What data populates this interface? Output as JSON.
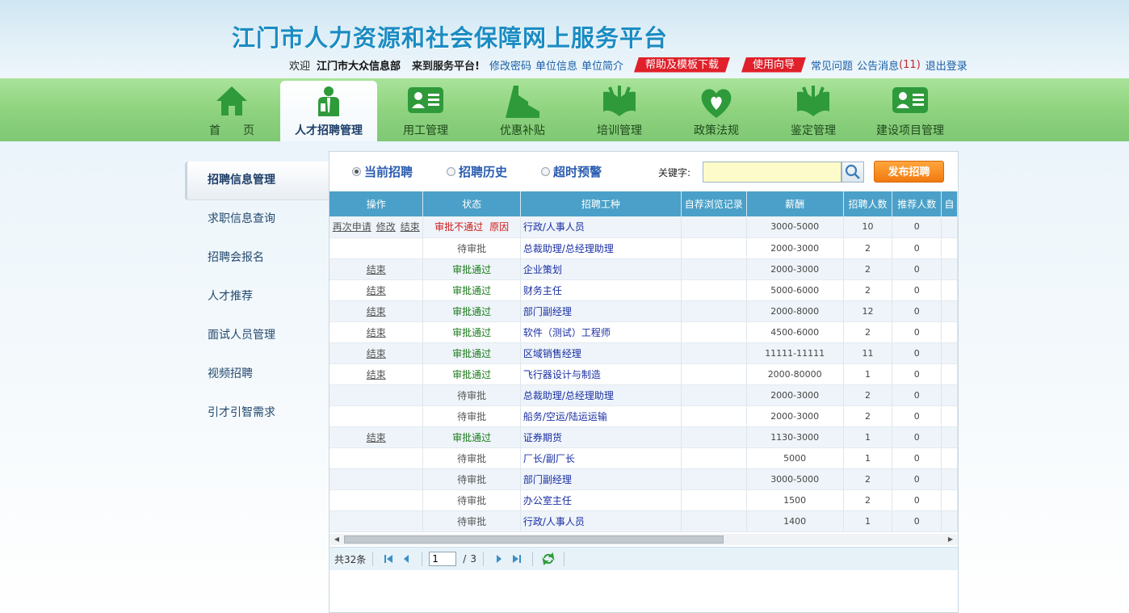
{
  "header": {
    "title": "江门市人力资源和社会保障网上服务平台",
    "welcome": "欢迎",
    "org": "江门市大众信息部",
    "welcome_suffix": "来到服务平台!",
    "links": [
      "修改密码",
      "单位信息",
      "单位简介"
    ],
    "help_download": "帮助及模板下载",
    "guide": "使用向导",
    "faq": "常见问题",
    "notice": "公告消息",
    "notice_count": "(11)",
    "logout": "退出登录"
  },
  "nav": {
    "items": [
      {
        "label": "首　　页",
        "icon": "home-icon"
      },
      {
        "label": "人才招聘管理",
        "icon": "recruit-person-icon"
      },
      {
        "label": "用工管理",
        "icon": "id-card-icon"
      },
      {
        "label": "优惠补贴",
        "icon": "building-icon"
      },
      {
        "label": "培训管理",
        "icon": "book-leaf-icon"
      },
      {
        "label": "政策法规",
        "icon": "heart-leaf-icon"
      },
      {
        "label": "鉴定管理",
        "icon": "book-leaf-icon"
      },
      {
        "label": "建设项目管理",
        "icon": "id-card-icon"
      }
    ],
    "active_index": 1,
    "accent": "#2e9a3a"
  },
  "sidebar": {
    "items": [
      "招聘信息管理",
      "求职信息查询",
      "招聘会报名",
      "人才推荐",
      "面试人员管理",
      "视频招聘",
      "引才引智需求"
    ],
    "active_index": 0
  },
  "filters": {
    "tabs": [
      "当前招聘",
      "招聘历史",
      "超时预警"
    ],
    "selected_index": 0,
    "keyword_label": "关键字:",
    "keyword_value": "",
    "publish_label": "发布招聘"
  },
  "table": {
    "columns": [
      "操作",
      "状态",
      "招聘工种",
      "自荐浏览记录",
      "薪酬",
      "招聘人数",
      "推荐人数",
      "自"
    ],
    "rows": [
      {
        "actions": [
          "再次申请",
          "修改",
          "结束"
        ],
        "status": "审批不通过",
        "status_type": "rejected",
        "reason": "原因",
        "job": "行政/人事人员",
        "views": "",
        "salary": "3000-5000",
        "hire": "10",
        "recommend": "0"
      },
      {
        "actions": [],
        "status": "待审批",
        "status_type": "pending",
        "reason": "",
        "job": "总裁助理/总经理助理",
        "views": "",
        "salary": "2000-3000",
        "hire": "2",
        "recommend": "0"
      },
      {
        "actions": [
          "结束"
        ],
        "status": "审批通过",
        "status_type": "approved",
        "reason": "",
        "job": "企业策划",
        "views": "",
        "salary": "2000-3000",
        "hire": "2",
        "recommend": "0"
      },
      {
        "actions": [
          "结束"
        ],
        "status": "审批通过",
        "status_type": "approved",
        "reason": "",
        "job": "财务主任",
        "views": "",
        "salary": "5000-6000",
        "hire": "2",
        "recommend": "0"
      },
      {
        "actions": [
          "结束"
        ],
        "status": "审批通过",
        "status_type": "approved",
        "reason": "",
        "job": "部门副经理",
        "views": "",
        "salary": "2000-8000",
        "hire": "12",
        "recommend": "0"
      },
      {
        "actions": [
          "结束"
        ],
        "status": "审批通过",
        "status_type": "approved",
        "reason": "",
        "job": "软件（测试）工程师",
        "views": "",
        "salary": "4500-6000",
        "hire": "2",
        "recommend": "0"
      },
      {
        "actions": [
          "结束"
        ],
        "status": "审批通过",
        "status_type": "approved",
        "reason": "",
        "job": "区域销售经理",
        "views": "",
        "salary": "11111-11111",
        "hire": "11",
        "recommend": "0"
      },
      {
        "actions": [
          "结束"
        ],
        "status": "审批通过",
        "status_type": "approved",
        "reason": "",
        "job": "飞行器设计与制造",
        "views": "",
        "salary": "2000-80000",
        "hire": "1",
        "recommend": "0"
      },
      {
        "actions": [],
        "status": "待审批",
        "status_type": "pending",
        "reason": "",
        "job": "总裁助理/总经理助理",
        "views": "",
        "salary": "2000-3000",
        "hire": "2",
        "recommend": "0"
      },
      {
        "actions": [],
        "status": "待审批",
        "status_type": "pending",
        "reason": "",
        "job": "船务/空运/陆运运输",
        "views": "",
        "salary": "2000-3000",
        "hire": "2",
        "recommend": "0"
      },
      {
        "actions": [
          "结束"
        ],
        "status": "审批通过",
        "status_type": "approved",
        "reason": "",
        "job": "证券期货",
        "views": "",
        "salary": "1130-3000",
        "hire": "1",
        "recommend": "0"
      },
      {
        "actions": [],
        "status": "待审批",
        "status_type": "pending",
        "reason": "",
        "job": "厂长/副厂长",
        "views": "",
        "salary": "5000",
        "hire": "1",
        "recommend": "0"
      },
      {
        "actions": [],
        "status": "待审批",
        "status_type": "pending",
        "reason": "",
        "job": "部门副经理",
        "views": "",
        "salary": "3000-5000",
        "hire": "2",
        "recommend": "0"
      },
      {
        "actions": [],
        "status": "待审批",
        "status_type": "pending",
        "reason": "",
        "job": "办公室主任",
        "views": "",
        "salary": "1500",
        "hire": "2",
        "recommend": "0"
      },
      {
        "actions": [],
        "status": "待审批",
        "status_type": "pending",
        "reason": "",
        "job": "行政/人事人员",
        "views": "",
        "salary": "1400",
        "hire": "1",
        "recommend": "0"
      }
    ]
  },
  "pager": {
    "total": "共32条",
    "page": "1",
    "of": "/",
    "pages": "3"
  }
}
